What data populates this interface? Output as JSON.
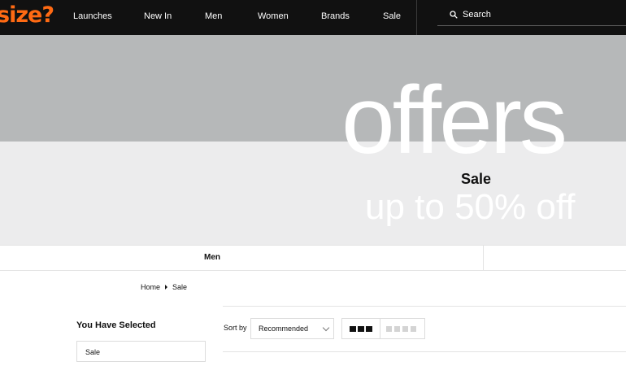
{
  "header": {
    "logo": "size?",
    "nav": [
      "Launches",
      "New In",
      "Men",
      "Women",
      "Brands",
      "Sale"
    ],
    "search_label": "Search"
  },
  "banner": {
    "headline": "offers",
    "title": "Sale",
    "subtitle": "up to 50% off"
  },
  "category_tabs": [
    "Men"
  ],
  "breadcrumb": [
    "Home",
    "Sale"
  ],
  "filters": {
    "heading": "You Have Selected",
    "chips": [
      "Sale"
    ]
  },
  "sort": {
    "label": "Sort by",
    "selected": "Recommended"
  },
  "colors": {
    "brand_orange": "#ff6a13",
    "nav_bg": "#111111",
    "banner_grey": "#b6b8b9",
    "banner_light": "#ececed"
  }
}
